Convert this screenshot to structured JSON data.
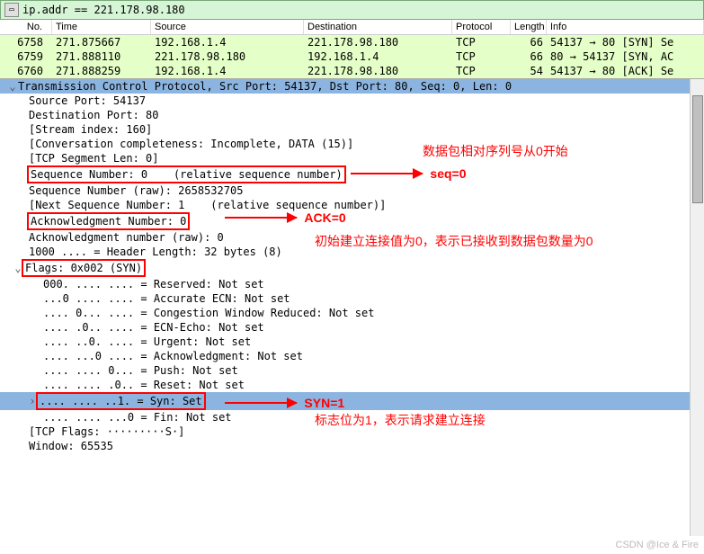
{
  "filter": {
    "text": "ip.addr == 221.178.98.180"
  },
  "columns": {
    "no": "No.",
    "time": "Time",
    "src": "Source",
    "dst": "Destination",
    "proto": "Protocol",
    "len": "Length",
    "info": "Info"
  },
  "packets": [
    {
      "no": "6758",
      "time": "271.875667",
      "src": "192.168.1.4",
      "dst": "221.178.98.180",
      "proto": "TCP",
      "len": "66",
      "info": "54137 → 80 [SYN] Se"
    },
    {
      "no": "6759",
      "time": "271.888110",
      "src": "221.178.98.180",
      "dst": "192.168.1.4",
      "proto": "TCP",
      "len": "66",
      "info": "80 → 54137 [SYN, AC"
    },
    {
      "no": "6760",
      "time": "271.888259",
      "src": "192.168.1.4",
      "dst": "221.178.98.180",
      "proto": "TCP",
      "len": "54",
      "info": "54137 → 80 [ACK] Se"
    }
  ],
  "detail": {
    "header": "Transmission Control Protocol, Src Port: 54137, Dst Port: 80, Seq: 0, Len: 0",
    "lines": {
      "srcport": "Source Port: 54137",
      "dstport": "Destination Port: 80",
      "stream": "[Stream index: 160]",
      "conv": "[Conversation completeness: Incomplete, DATA (15)]",
      "seglen": "[TCP Segment Len: 0]",
      "seqnum": "Sequence Number: 0    (relative sequence number)",
      "seqraw": "Sequence Number (raw): 2658532705",
      "nextseq": "[Next Sequence Number: 1    (relative sequence number)]",
      "acknum": "Acknowledgment Number: 0",
      "ackraw": "Acknowledgment number (raw): 0",
      "hdrlen": "1000 .... = Header Length: 32 bytes (8)",
      "flags": "Flags: 0x002 (SYN)",
      "f_res": "000. .... .... = Reserved: Not set",
      "f_ae": "...0 .... .... = Accurate ECN: Not set",
      "f_cwr": ".... 0... .... = Congestion Window Reduced: Not set",
      "f_ece": ".... .0.. .... = ECN-Echo: Not set",
      "f_urg": ".... ..0. .... = Urgent: Not set",
      "f_ack": ".... ...0 .... = Acknowledgment: Not set",
      "f_psh": ".... .... 0... = Push: Not set",
      "f_rst": ".... .... .0.. = Reset: Not set",
      "f_syn": ".... .... ..1. = Syn: Set",
      "f_fin": ".... .... ...0 = Fin: Not set",
      "tcpflags": "[TCP Flags: ·········S·]",
      "window": "Window: 65535"
    }
  },
  "annotations": {
    "seq0": "seq=0",
    "seq0_note": "数据包相对序列号从0开始",
    "ack0": "ACK=0",
    "ack0_note": "初始建立连接值为0，表示已接收到数据包数量为0",
    "syn1": "SYN=1",
    "syn1_note": "标志位为1，表示请求建立连接"
  },
  "watermark": "CSDN @Ice & Fire"
}
